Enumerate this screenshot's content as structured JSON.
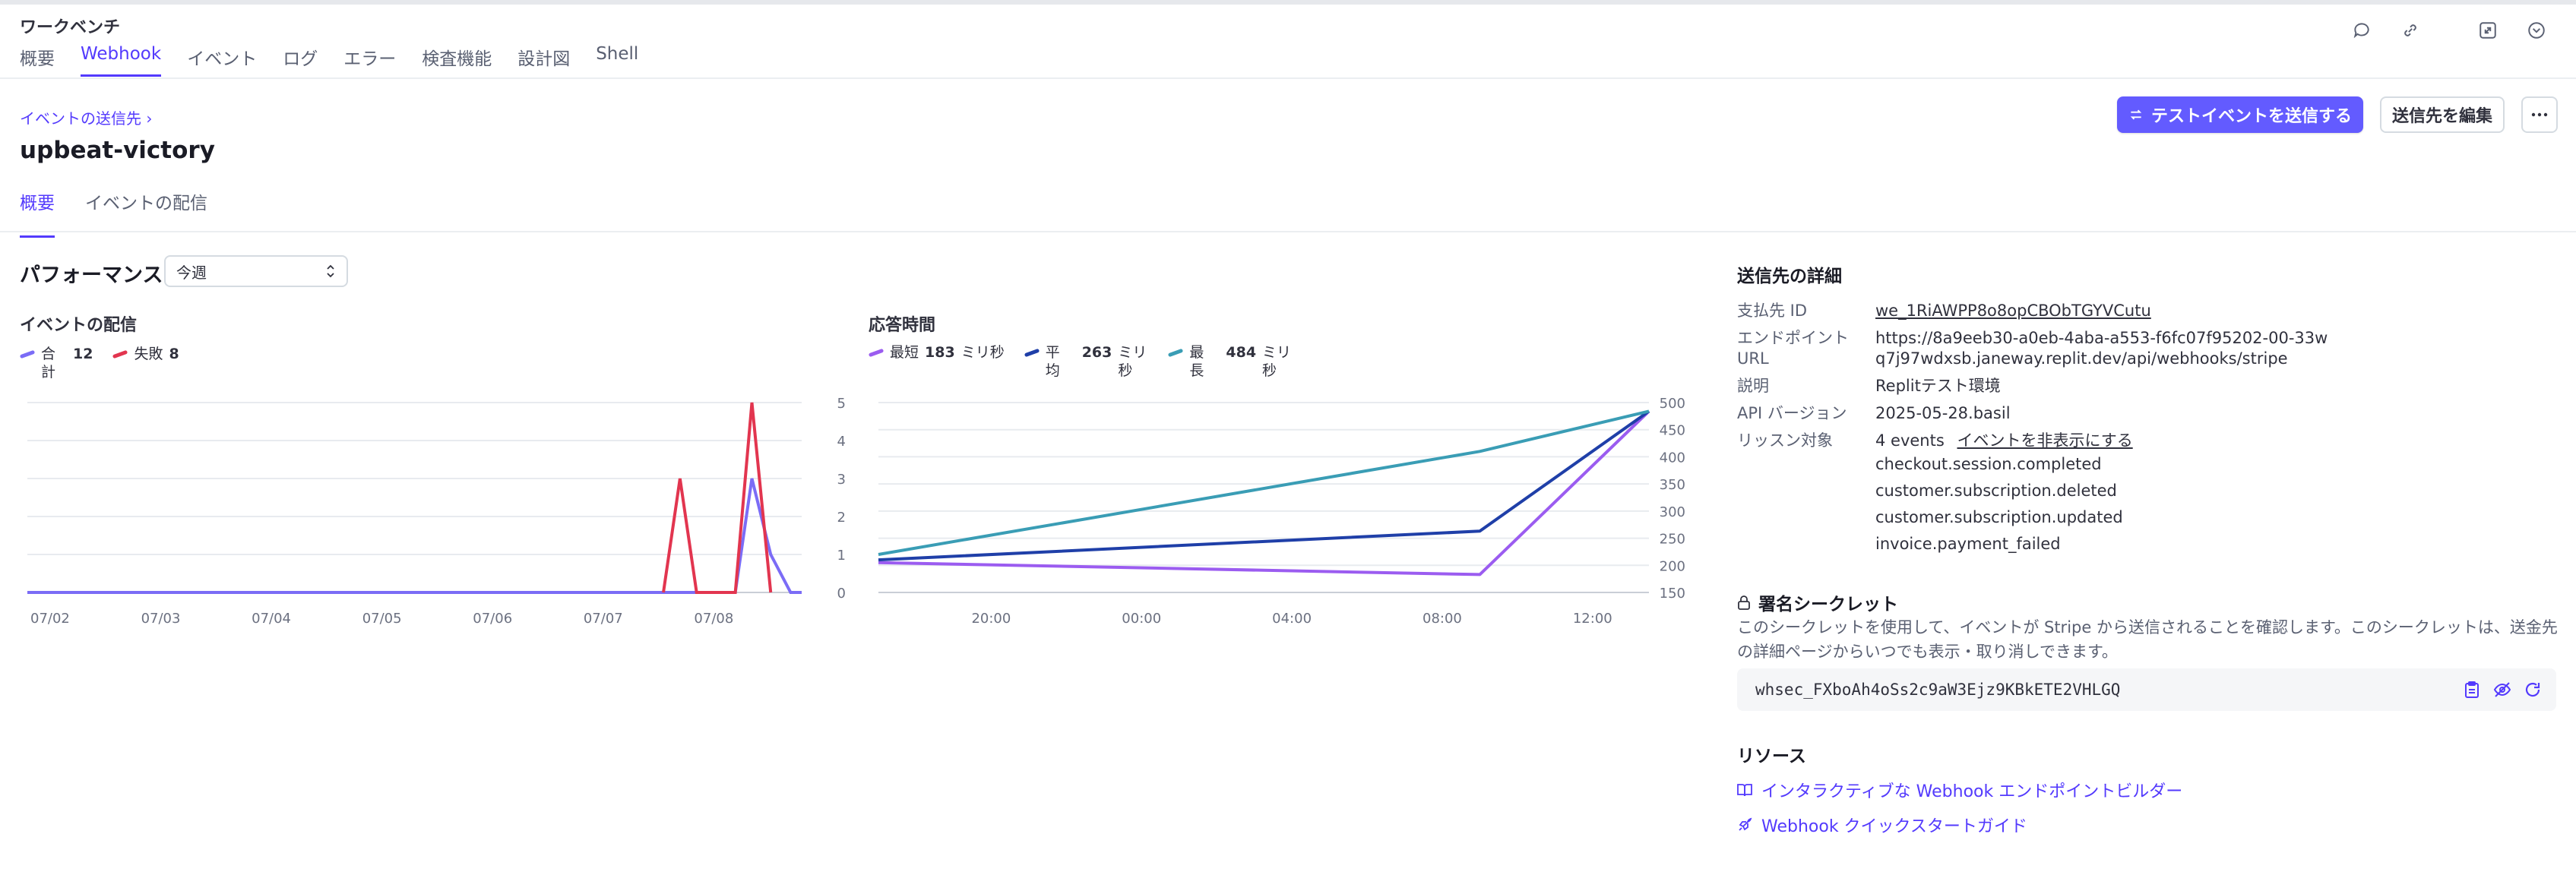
{
  "workbench": {
    "title": "ワークベンチ",
    "tabs": [
      "概要",
      "Webhook",
      "イベント",
      "ログ",
      "エラー",
      "検査機能",
      "設計図",
      "Shell"
    ],
    "active_tab": 1
  },
  "top_icons": [
    "chat-icon",
    "link-icon",
    "expand-icon",
    "collapse-icon"
  ],
  "breadcrumb": "イベントの送信先",
  "page_title": "upbeat-victory",
  "actions": {
    "send_test": "テストイベントを送信する",
    "edit": "送信先を編集",
    "more": "⋯"
  },
  "sub_tabs": [
    "概要",
    "イベントの配信"
  ],
  "performance": {
    "title": "パフォーマンス",
    "period": "今週"
  },
  "colors": {
    "accent": "#533afd",
    "primary_button": "#635bff",
    "total": "#7b6cf6",
    "failed": "#e2354f",
    "min": "#9b5cf0",
    "avg": "#1f3fa8",
    "max": "#3a9db5"
  },
  "delivery_chart": {
    "title": "イベントの配信",
    "legend": [
      {
        "name": "合計",
        "value": "12"
      },
      {
        "name": "失敗",
        "value": "8"
      }
    ]
  },
  "response_chart": {
    "title": "応答時間",
    "legend": [
      {
        "name": "最短",
        "value": "183",
        "unit": "ミリ秒"
      },
      {
        "name": "平均",
        "value": "263",
        "unit": "ミリ秒"
      },
      {
        "name": "最長",
        "value": "484",
        "unit": "ミリ秒"
      }
    ]
  },
  "chart_data": [
    {
      "type": "line",
      "title": "イベントの配信",
      "x_ticks": [
        "07/02",
        "07/03",
        "07/04",
        "07/05",
        "07/06",
        "07/07",
        "07/08"
      ],
      "ylim": [
        0,
        5
      ],
      "y_ticks": [
        0,
        1,
        2,
        3,
        4,
        5
      ],
      "grid": true,
      "x_range": [
        0,
        7
      ],
      "series": [
        {
          "name": "合計",
          "x": [
            0,
            6.4,
            6.55,
            6.72,
            6.9,
            7.0
          ],
          "values": [
            0,
            0,
            3,
            1,
            0,
            0
          ]
        },
        {
          "name": "失敗",
          "x": [
            5.75,
            5.9,
            6.05,
            6.4,
            6.55,
            6.72
          ],
          "values": [
            0,
            3,
            0,
            0,
            5,
            0
          ]
        }
      ]
    },
    {
      "type": "line",
      "title": "応答時間",
      "x_ticks": [
        "20:00",
        "00:00",
        "04:00",
        "08:00",
        "12:00"
      ],
      "x_tick_hours": [
        20,
        24,
        28,
        32,
        36
      ],
      "x_range": [
        17,
        37.5
      ],
      "ylim": [
        150,
        500
      ],
      "y_ticks": [
        150,
        200,
        250,
        300,
        350,
        400,
        450,
        500
      ],
      "grid": true,
      "series": [
        {
          "name": "最短",
          "x": [
            17,
            33
          ],
          "values": [
            205,
            183
          ],
          "x2": [
            33,
            37.5
          ],
          "values2": [
            183,
            484
          ]
        },
        {
          "name": "平均",
          "x": [
            17,
            33
          ],
          "values": [
            210,
            263
          ],
          "x2": [
            33,
            37.5
          ],
          "values2": [
            263,
            484
          ]
        },
        {
          "name": "最長",
          "x": [
            17,
            33
          ],
          "values": [
            220,
            410
          ],
          "x2": [
            33,
            37.5
          ],
          "values2": [
            410,
            484
          ]
        }
      ]
    }
  ],
  "details": {
    "title": "送信先の詳細",
    "rows": [
      {
        "key": "支払先 ID",
        "value": "we_1RiAWPP8o8opCBObTGYVCutu"
      },
      {
        "key": "エンドポイント URL",
        "value": "https://8a9eeb30-a0eb-4aba-a553-f6fc07f95202-00-33wq7j97wdxsb.janeway.replit.dev/api/webhooks/stripe"
      },
      {
        "key": "説明",
        "value": "Replitテスト環境"
      },
      {
        "key": "API バージョン",
        "value": "2025-05-28.basil"
      }
    ],
    "listen": {
      "key": "リッスン対象",
      "count": "4 events",
      "hide_link": "イベントを非表示にする",
      "events": [
        "checkout.session.completed",
        "customer.subscription.deleted",
        "customer.subscription.updated",
        "invoice.payment_failed"
      ]
    }
  },
  "secret": {
    "title": "署名シークレット",
    "description": "このシークレットを使用して、イベントが Stripe から送信されることを確認します。このシークレットは、送金先の詳細ページからいつでも表示・取り消しできます。",
    "value": "whsec_FXboAh4oSs2c9aW3Ejz9KBkETE2VHLGQ"
  },
  "resources": {
    "title": "リソース",
    "links": [
      "インタラクティブな Webhook エンドポイントビルダー",
      "Webhook クイックスタートガイド"
    ]
  }
}
